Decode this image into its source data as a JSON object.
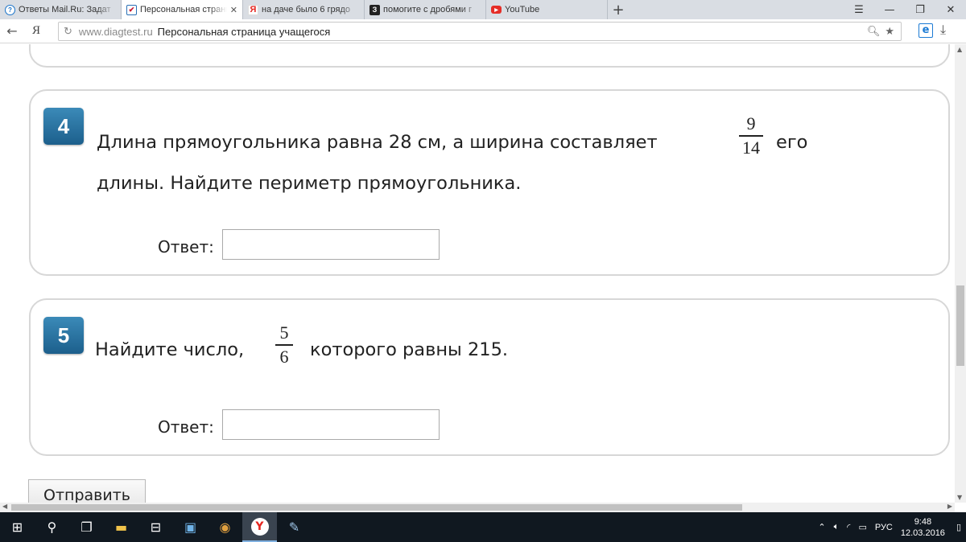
{
  "browser": {
    "tabs": [
      {
        "icon": "mail-answers-icon",
        "title": "Ответы Mail.Ru: Задат",
        "active": false
      },
      {
        "icon": "diagtest-icon",
        "title": "Персональная страни",
        "active": true
      },
      {
        "icon": "yandex-icon",
        "title": "на даче было 6 грядо",
        "active": false
      },
      {
        "icon": "znanija-icon",
        "title": "помогите с дробями г",
        "active": false
      },
      {
        "icon": "youtube-icon",
        "title": "YouTube",
        "active": false
      }
    ],
    "new_tab_label": "+",
    "address": {
      "host": "www.diagtest.ru",
      "page_title": "Персональная страница учащегося"
    }
  },
  "questions": [
    {
      "number": "4",
      "text_before": "Длина прямоугольника равна  28 см, а ширина составляет",
      "fraction": {
        "numerator": "9",
        "denominator": "14"
      },
      "text_after": "его",
      "text_line2": "длины. Найдите периметр прямоугольника.",
      "answer_label": "Ответ:",
      "answer_value": ""
    },
    {
      "number": "5",
      "text_before": "Найдите число,",
      "fraction": {
        "numerator": "5",
        "denominator": "6"
      },
      "text_after": "которого равны 215.",
      "answer_label": "Ответ:",
      "answer_value": ""
    }
  ],
  "submit_label": "Отправить",
  "taskbar": {
    "language": "РУС",
    "time": "9:48",
    "date": "12.03.2016"
  }
}
